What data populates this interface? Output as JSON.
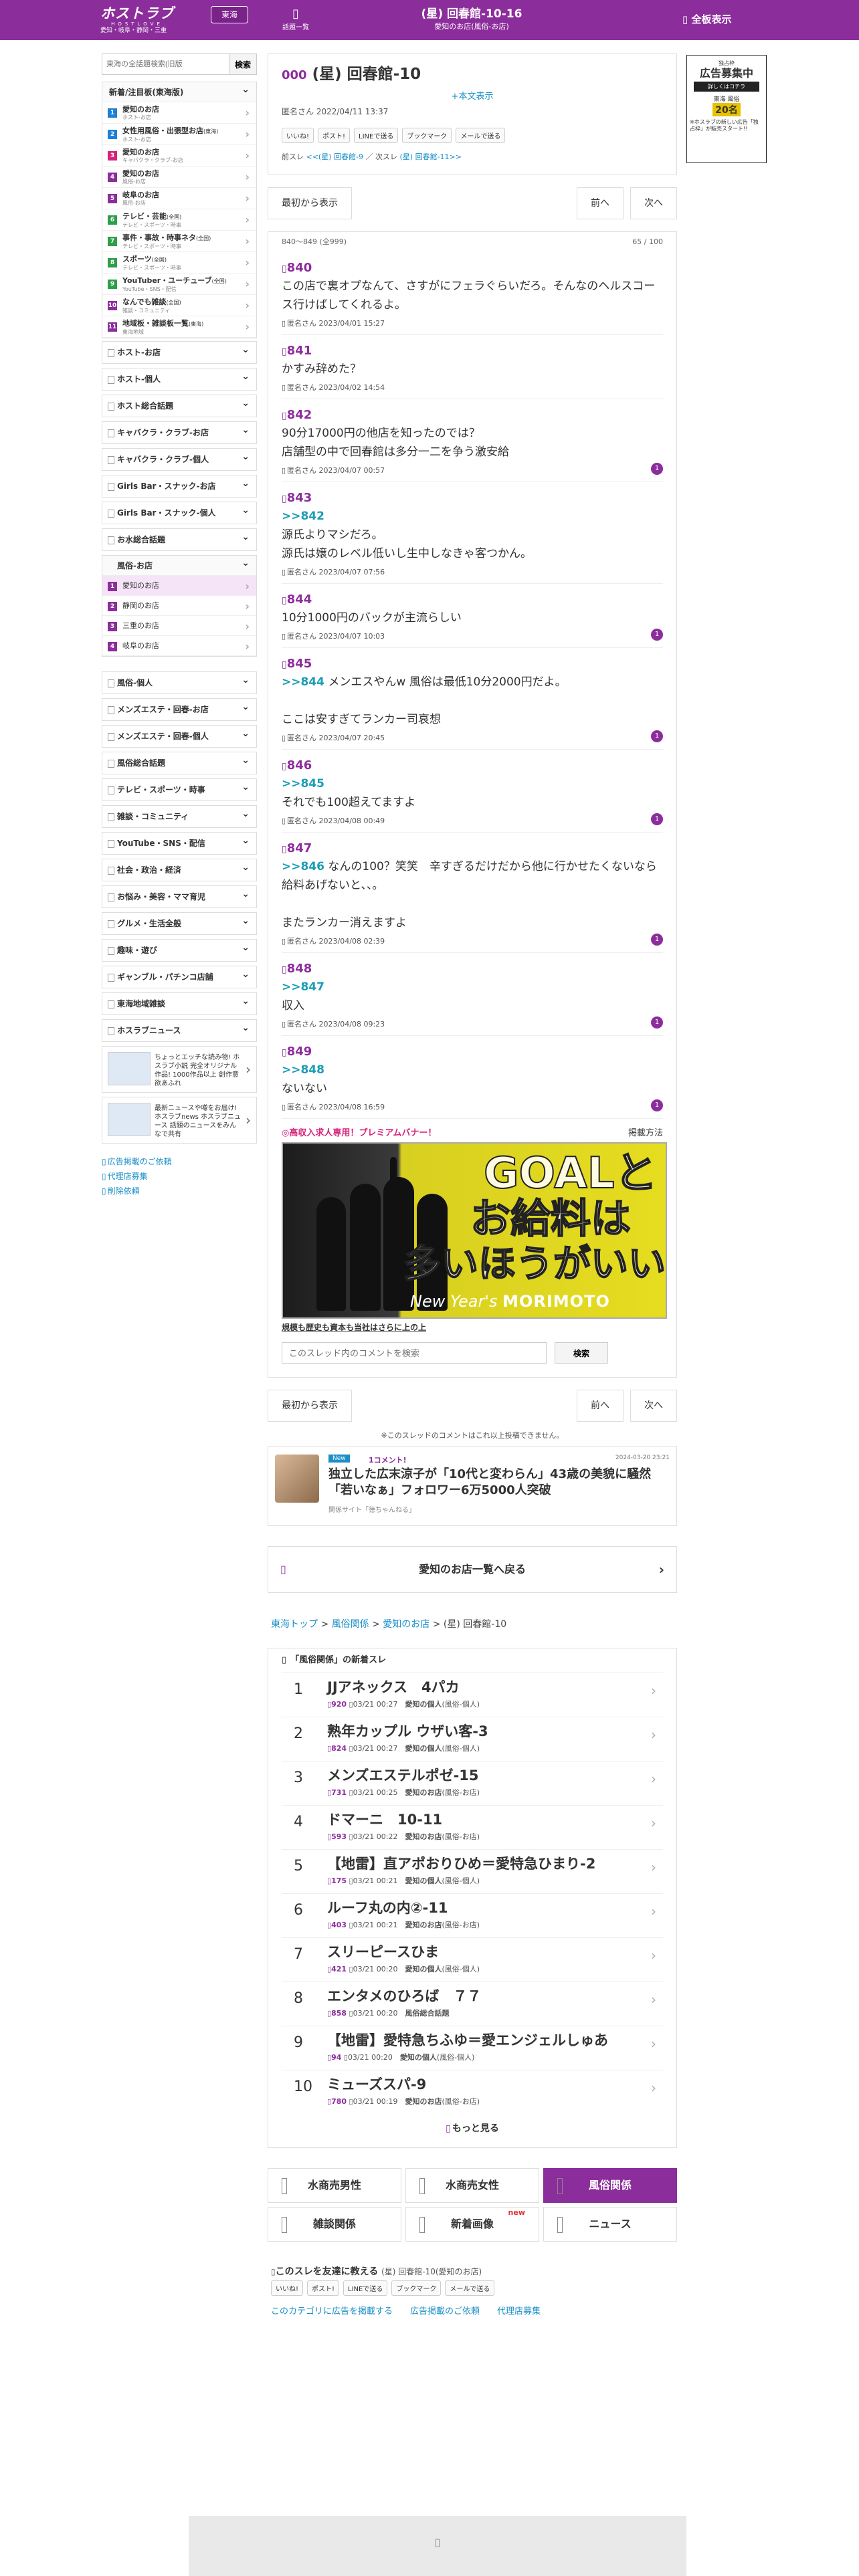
{
  "header": {
    "logo_main": "ホストラブ",
    "logo_sub": "HOSTLOVE",
    "logo_area": "愛知・岐阜・静岡・三重",
    "region": "東海",
    "board_list": "話題一覧",
    "thread_title": "(星) 回春館-10-16",
    "thread_category": "愛知のお店(風俗-お店)",
    "all_view": "全板表示"
  },
  "sidebar": {
    "search_placeholder": "東海の全話題検索(旧版",
    "search_button": "検索",
    "new_head": "新着/注目板(東海版)",
    "new_items": [
      {
        "num": "1",
        "name": "愛知のお店",
        "sub": "ホスト-お店",
        "color": "#1e7fd6"
      },
      {
        "num": "2",
        "name": "女性用風俗・出張型お店",
        "tag": "(東海)",
        "sub": "ホスト-お店",
        "color": "#1e7fd6"
      },
      {
        "num": "3",
        "name": "愛知のお店",
        "sub": "キャバクラ・クラブ-お店",
        "color": "#d6237a"
      },
      {
        "num": "4",
        "name": "愛知のお店",
        "sub": "風俗-お店",
        "color": "#8c2d9c"
      },
      {
        "num": "5",
        "name": "岐阜のお店",
        "sub": "風俗-お店",
        "color": "#8c2d9c"
      },
      {
        "num": "6",
        "name": "テレビ・芸能",
        "tag": "(全国)",
        "sub": "テレビ・スポーツ・時事",
        "color": "#2e9e4a"
      },
      {
        "num": "7",
        "name": "事件・事故・時事ネタ",
        "tag": "(全国)",
        "sub": "テレビ・スポーツ・時事",
        "color": "#2e9e4a"
      },
      {
        "num": "8",
        "name": "スポーツ",
        "tag": "(全国)",
        "sub": "テレビ・スポーツ・時事",
        "color": "#2e9e4a"
      },
      {
        "num": "9",
        "name": "YouTuber・ユーチューブ",
        "tag": "(全国)",
        "sub": "YouTube・SNS・配信",
        "color": "#2e9e4a"
      },
      {
        "num": "10",
        "name": "なんでも雑談",
        "tag": "(全国)",
        "sub": "雑談・コミュニティ",
        "color": "#8c2d9c"
      },
      {
        "num": "11",
        "name": "地域板・雑談板一覧",
        "tag": "(東海)",
        "sub": "東海地域",
        "color": "#8c2d9c"
      }
    ],
    "sections_a": [
      "ホスト-お店",
      "ホスト-個人",
      "ホスト総合話題",
      "キャバクラ・クラブ-お店",
      "キャバクラ・クラブ-個人",
      "Girls Bar・スナック-お店",
      "Girls Bar・スナック-個人",
      "お水総合話題"
    ],
    "fuzoku_head": "風俗-お店",
    "fuzoku_items": [
      {
        "num": "1",
        "name": "愛知のお店"
      },
      {
        "num": "2",
        "name": "静岡のお店"
      },
      {
        "num": "3",
        "name": "三重のお店"
      },
      {
        "num": "4",
        "name": "岐阜のお店"
      }
    ],
    "sections_b": [
      "風俗-個人",
      "メンズエステ・回春-お店",
      "メンズエステ・回春-個人",
      "風俗総合話題",
      "テレビ・スポーツ・時事",
      "雑談・コミュニティ",
      "YouTube・SNS・配信",
      "社会・政治・経済",
      "お悩み・美容・ママ育児",
      "グルメ・生活全般",
      "趣味・遊び",
      "ギャンブル・パチンコ店舗",
      "東海地域雑談",
      "ホスラブニュース"
    ],
    "banner1": "ちょっとエッチな読み物! ホスラブ小説 完全オリジナル作品! 1000作品以上 創作意欲あふれ",
    "banner2": "最新ニュースや噂をお届け! ホスラブnews ホスラブニュース 話題のニュースをみんなで共有",
    "links": [
      "広告掲載のご依頼",
      "代理店募集",
      "削除依頼"
    ]
  },
  "ad": {
    "line1": "独占枠",
    "line2": "広告募集中",
    "line3": "詳しくはコチラ",
    "line4": "東海 風俗",
    "price": "20名",
    "note": "※ホスラブの新しい広告「独占枠」が販売スタート!!"
  },
  "thread": {
    "no": "000",
    "title": "(星) 回春館-10",
    "full": "+本文表示",
    "meta": "匿名さん 2022/04/11 13:37",
    "shares": [
      "いいね!",
      "ポスト!",
      "LINEで送る",
      "ブックマーク",
      "メールで送る"
    ],
    "prev_label": "前スレ",
    "prev_link": "<<(星) 回春館-9",
    "next_label": "次スレ",
    "next_link": "(星) 回春館-11>>"
  },
  "nav": {
    "first": "最初から表示",
    "prev": "前へ",
    "next": "次へ"
  },
  "posts_info": {
    "range": "840～849 (全999)",
    "count": "65 / 100"
  },
  "posts": [
    {
      "no": "840",
      "reply": "",
      "body": "この店で裏オプなんて、さすがにフェラぐらいだろ。そんなのヘルスコース行けばしてくれるよ。",
      "meta": "匿名さん 2023/04/01 15:27",
      "badge": ""
    },
    {
      "no": "841",
      "reply": "",
      "body": "かすみ辞めた？",
      "meta": "匿名さん 2023/04/02 14:54",
      "badge": ""
    },
    {
      "no": "842",
      "reply": "",
      "body": "90分17000円の他店を知ったのでは？\n店舗型の中で回春館は多分一二を争う激安給",
      "meta": "匿名さん 2023/04/07 00:57",
      "badge": "1"
    },
    {
      "no": "843",
      "reply": ">>842",
      "body": "源氏よりマシだろ。\n源氏は嬢のレベル低いし生中しなきゃ客つかん。",
      "meta": "匿名さん 2023/04/07 07:56",
      "badge": ""
    },
    {
      "no": "844",
      "reply": "",
      "body": "10分1000円のバックが主流らしい",
      "meta": "匿名さん 2023/04/07 10:03",
      "badge": "1"
    },
    {
      "no": "845",
      "reply": ">>844",
      "body": " メンエスやんw 風俗は最低10分2000円だよ。\n\nここは安すぎてランカー司哀想",
      "meta": "匿名さん 2023/04/07 20:45",
      "badge": "1"
    },
    {
      "no": "846",
      "reply": ">>845",
      "body": "それでも100超えてますよ",
      "meta": "匿名さん 2023/04/08 00:49",
      "badge": "1"
    },
    {
      "no": "847",
      "reply": ">>846",
      "body": " なんの100？笑笑　辛すぎるだけだから他に行かせたくないなら給料あげないと、、。\n\nまたランカー消えますよ",
      "meta": "匿名さん 2023/04/08 02:39",
      "badge": "1"
    },
    {
      "no": "848",
      "reply": ">>847",
      "body": "収入",
      "meta": "匿名さん 2023/04/08 09:23",
      "badge": "1"
    },
    {
      "no": "849",
      "reply": ">>848",
      "body": "ないない",
      "meta": "匿名さん 2023/04/08 16:59",
      "badge": "1"
    }
  ],
  "premium": {
    "title": "高収入求人専用！プレミアムバナー！",
    "how": "掲載方法",
    "copy1": "GOALと",
    "copy2": "お給料は",
    "copy3": "多いほうがいい",
    "brand_a": "New Year's",
    "brand_b": "MORIMOTO",
    "caption": "規模も歴史も資本も当社はさらに上の上"
  },
  "comment_search": {
    "placeholder": "このスレッド内のコメントを検索",
    "button": "検索"
  },
  "notice": "※このスレッドのコメントはこれ以上投稿できません。",
  "news": {
    "tag": "New",
    "comments": "1コメント!",
    "date": "2024-03-20 23:21",
    "title": "独立した広末涼子が「10代と変わらん」43歳の美貌に騒然「若いなぁ」フォロワー6万5000人突破",
    "source": "関係サイト「徳ちゃんねる」"
  },
  "back": "愛知のお店一覧へ戻る",
  "breadcrumb": {
    "a": "東海トップ",
    "b": "風俗関係",
    "c": "愛知のお店",
    "d": "(星) 回春館-10"
  },
  "latest": {
    "head": "「風俗関係」の新着スレ",
    "items": [
      {
        "rank": "1",
        "title": "JJアネックス　4パカ",
        "count": "920",
        "date": "03/21 00:27",
        "board": "愛知の個人",
        "cat": "(風俗-個人)"
      },
      {
        "rank": "2",
        "title": "熟年カップル ウザい客-3",
        "count": "824",
        "date": "03/21 00:27",
        "board": "愛知の個人",
        "cat": "(風俗-個人)"
      },
      {
        "rank": "3",
        "title": "メンズエステルポゼ-15",
        "count": "731",
        "date": "03/21 00:25",
        "board": "愛知のお店",
        "cat": "(風俗-お店)"
      },
      {
        "rank": "4",
        "title": "ドマーニ　10-11",
        "count": "593",
        "date": "03/21 00:22",
        "board": "愛知のお店",
        "cat": "(風俗-お店)"
      },
      {
        "rank": "5",
        "title": "【地雷】直アポおりひめ＝愛特急ひまり-2",
        "count": "175",
        "date": "03/21 00:21",
        "board": "愛知の個人",
        "cat": "(風俗-個人)"
      },
      {
        "rank": "6",
        "title": "ルーフ丸の内②-11",
        "count": "403",
        "date": "03/21 00:21",
        "board": "愛知のお店",
        "cat": "(風俗-お店)"
      },
      {
        "rank": "7",
        "title": "スリーピースひま",
        "count": "421",
        "date": "03/21 00:20",
        "board": "愛知の個人",
        "cat": "(風俗-個人)"
      },
      {
        "rank": "8",
        "title": "エンタメのひろば　７７",
        "count": "858",
        "date": "03/21 00:20",
        "board": "風俗総合話題",
        "cat": ""
      },
      {
        "rank": "9",
        "title": "【地雷】愛特急ちふゆ＝愛エンジェルしゅあ",
        "count": "94",
        "date": "03/21 00:20",
        "board": "愛知の個人",
        "cat": "(風俗-個人)"
      },
      {
        "rank": "10",
        "title": "ミューズスパ-9",
        "count": "780",
        "date": "03/21 00:19",
        "board": "愛知のお店",
        "cat": "(風俗-お店)"
      }
    ],
    "more": "もっと見る"
  },
  "cats": [
    {
      "label": "水商売男性"
    },
    {
      "label": "水商売女性"
    },
    {
      "label": "風俗関係"
    },
    {
      "label": "雑談関係"
    },
    {
      "label": "新着画像",
      "new": "new"
    },
    {
      "label": "ニュース"
    }
  ],
  "share_bottom": {
    "title": "このスレを友達に教える",
    "sub": "(星) 回春館-10(愛知のお店)",
    "shares": [
      "いいね!",
      "ポスト!",
      "LINEで送る",
      "ブックマーク",
      "メールで送る"
    ],
    "links": [
      "このカテゴリに広告を掲載する",
      "広告掲載のご依頼",
      "代理店募集"
    ]
  },
  "colors": {
    "brand": "#8c2d9c",
    "link": "#1a8fc8",
    "reply": "#1a9db5"
  }
}
